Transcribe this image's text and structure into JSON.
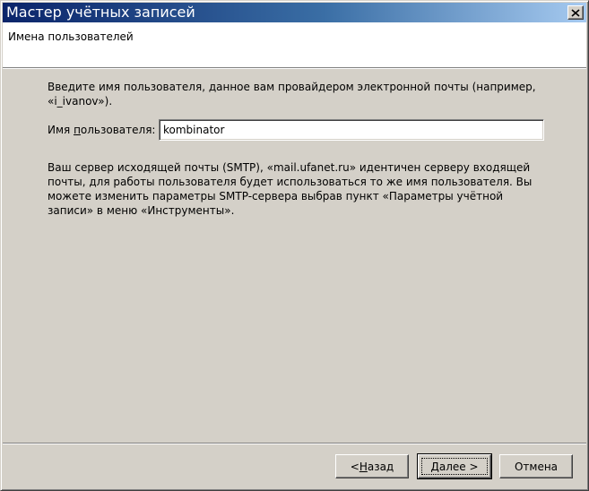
{
  "window": {
    "title": "Мастер учётных записей",
    "close_icon": "close-icon"
  },
  "header": {
    "title": "Имена пользователей"
  },
  "intro_text": "Введите имя пользователя, данное вам провайдером электронной почты (например, «i_ivanov»).",
  "username": {
    "label_prefix": "Имя ",
    "label_accel": "п",
    "label_suffix": "ользователя:",
    "value": "kombinator"
  },
  "smtp_note": "Ваш сервер исходящей почты (SMTP), «mail.ufanet.ru» идентичен серверу входящей почты, для работы пользователя будет использоваться то же имя пользователя. Вы можете изменить параметры SMTP-сервера выбрав пункт «Параметры учётной записи» в меню «Инструменты».",
  "buttons": {
    "back_prefix": "< ",
    "back_accel": "Н",
    "back_suffix": "азад",
    "next_accel": "Д",
    "next_suffix": "алее >",
    "cancel": "Отмена"
  },
  "colors": {
    "title_start": "#0a246a",
    "title_end": "#a6caf0",
    "face": "#d4d0c8"
  }
}
